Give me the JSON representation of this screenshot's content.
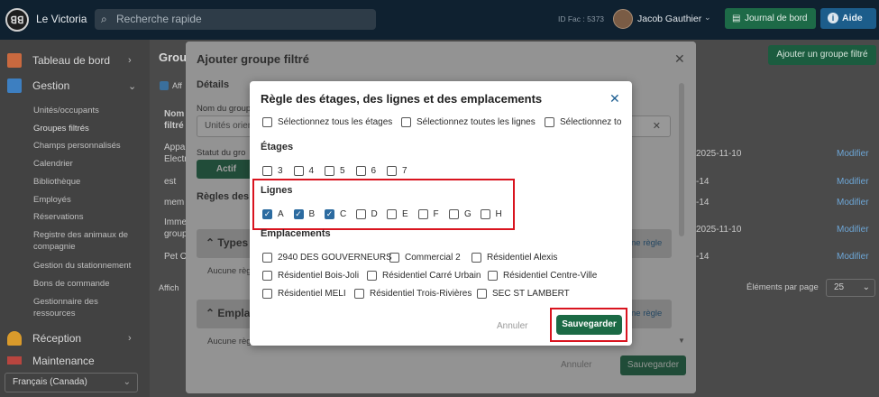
{
  "app": {
    "name": "Le Victoria",
    "logo_text": "ꓭꓭ"
  },
  "topbar": {
    "search_placeholder": "Recherche rapide",
    "id_fac": "ID Fac : 5373",
    "user_name": "Jacob Gauthier",
    "journal_label": "Journal de bord",
    "aide_label": "Aide"
  },
  "sidebar": {
    "main_items": [
      {
        "label": "Tableau de bord",
        "icon": "home-icon",
        "color": "#e07a5f"
      },
      {
        "label": "Gestion",
        "icon": "building-icon",
        "color": "#3d7fc1"
      },
      {
        "label": "Réception",
        "icon": "bell-icon",
        "color": "#e0a030"
      },
      {
        "label": "Maintenance",
        "icon": "wrench-icon",
        "color": "#c0504d"
      }
    ],
    "sub_items": [
      "Unités/occupants",
      "Groupes filtrés",
      "Champs personnalisés",
      "Calendrier",
      "Bibliothèque",
      "Employés",
      "Réservations",
      "Registre des animaux de compagnie",
      "Gestion du stationnement",
      "Bons de commande",
      "Gestionnaire des ressources"
    ],
    "language": "Français (Canada)"
  },
  "main": {
    "title": "Group",
    "add_group_label": "Ajouter un groupe filtré",
    "checkbox_label": "Aff",
    "col_nom": "Nom",
    "col_filtre": "filtré",
    "rows": [
      {
        "name": "Appa",
        "name2": "Electr",
        "date": "2025-11-10",
        "action": "Modifier"
      },
      {
        "name": "est",
        "date": "-14",
        "action": "Modifier"
      },
      {
        "name": "mem",
        "date": "-14",
        "action": "Modifier"
      },
      {
        "name": "Imme",
        "name2": "group",
        "date": "2025-11-10",
        "action": "Modifier"
      },
      {
        "name": "Pet O",
        "date": "-14",
        "action": "Modifier"
      }
    ],
    "affich": "Affich",
    "elements_label": "Éléments par page",
    "elements_value": "25"
  },
  "modal1": {
    "title": "Ajouter groupe filtré",
    "details": "Détails",
    "nom_label": "Nom du group",
    "nom_value": "Unités orien",
    "statut_label": "Statut du gro",
    "actif": "Actif",
    "regles": "Règles des",
    "types": "Types",
    "aucune1": "Aucune règ",
    "empla": "Empla",
    "aucune2": "Aucune règ",
    "ne_regle": "ne règle",
    "cancel": "Annuler",
    "save": "Sauvegarder"
  },
  "modal2": {
    "title": "Règle des étages, des lignes et des emplacements",
    "select_all": [
      {
        "label": "Sélectionnez tous les étages",
        "checked": false
      },
      {
        "label": "Sélectionnez toutes les lignes",
        "checked": false
      },
      {
        "label": "Sélectionnez tou",
        "checked": false
      }
    ],
    "etages_title": "Étages",
    "etages": [
      {
        "label": "3",
        "checked": false
      },
      {
        "label": "4",
        "checked": false
      },
      {
        "label": "5",
        "checked": false
      },
      {
        "label": "6",
        "checked": false
      },
      {
        "label": "7",
        "checked": false
      }
    ],
    "lignes_title": "Lignes",
    "lignes": [
      {
        "label": "A",
        "checked": true
      },
      {
        "label": "B",
        "checked": true
      },
      {
        "label": "C",
        "checked": true
      },
      {
        "label": "D",
        "checked": false
      },
      {
        "label": "E",
        "checked": false
      },
      {
        "label": "F",
        "checked": false
      },
      {
        "label": "G",
        "checked": false
      },
      {
        "label": "H",
        "checked": false
      }
    ],
    "emplacements_title": "Emplacements",
    "emplacements": [
      {
        "label": "2940 DES GOUVERNEURS",
        "checked": false
      },
      {
        "label": "Commercial 2",
        "checked": false
      },
      {
        "label": "Résidentiel Alexis",
        "checked": false
      },
      {
        "label": "Résidentiel Bois-Joli",
        "checked": false
      },
      {
        "label": "Résidentiel Carré Urbain",
        "checked": false
      },
      {
        "label": "Résidentiel Centre-Ville",
        "checked": false
      },
      {
        "label": "Résidentiel MELI",
        "checked": false
      },
      {
        "label": "Résidentiel Trois-Rivières",
        "checked": false
      },
      {
        "label": "SEC ST LAMBERT",
        "checked": false
      }
    ],
    "cancel": "Annuler",
    "save": "Sauvegarder"
  }
}
